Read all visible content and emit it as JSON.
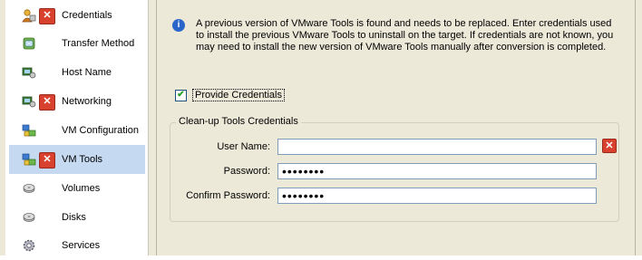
{
  "sidebar": {
    "items": [
      {
        "label": "Credentials",
        "icon": "credentials-icon",
        "error": true,
        "selected": false
      },
      {
        "label": "Transfer Method",
        "icon": "transfer-icon",
        "error": false,
        "selected": false
      },
      {
        "label": "Host Name",
        "icon": "host-icon",
        "error": false,
        "selected": false
      },
      {
        "label": "Networking",
        "icon": "network-icon",
        "error": true,
        "selected": false
      },
      {
        "label": "VM Configuration",
        "icon": "vm-config-icon",
        "error": false,
        "selected": false
      },
      {
        "label": "VM Tools",
        "icon": "vm-tools-icon",
        "error": true,
        "selected": true
      },
      {
        "label": "Volumes",
        "icon": "disk-icon",
        "error": false,
        "selected": false
      },
      {
        "label": "Disks",
        "icon": "disk-icon",
        "error": false,
        "selected": false
      },
      {
        "label": "Services",
        "icon": "gear-icon",
        "error": false,
        "selected": false
      }
    ]
  },
  "main": {
    "info_text": "A previous version of VMware Tools is found and needs to be replaced.  Enter credentials used to install the previous VMware Tools to uninstall on the target.  If credentials are not known, you may need to install the new version of VMware Tools manually after conversion is completed.",
    "provide_credentials": {
      "label": "Provide Credentials",
      "checked": true,
      "check_mark": "✔"
    },
    "group": {
      "title": "Clean-up Tools Credentials",
      "username_label": "User Name:",
      "username_value": "",
      "password_label": "Password:",
      "password_value": "••••••••",
      "confirm_label": "Confirm Password:",
      "confirm_value": "••••••••"
    },
    "error_glyph": "✕",
    "info_glyph": "i"
  },
  "colors": {
    "selected_bg": "#c5d9f1",
    "panel_bg": "#ece9d8",
    "error_red": "#d9412f",
    "info_blue": "#2a66c9"
  }
}
